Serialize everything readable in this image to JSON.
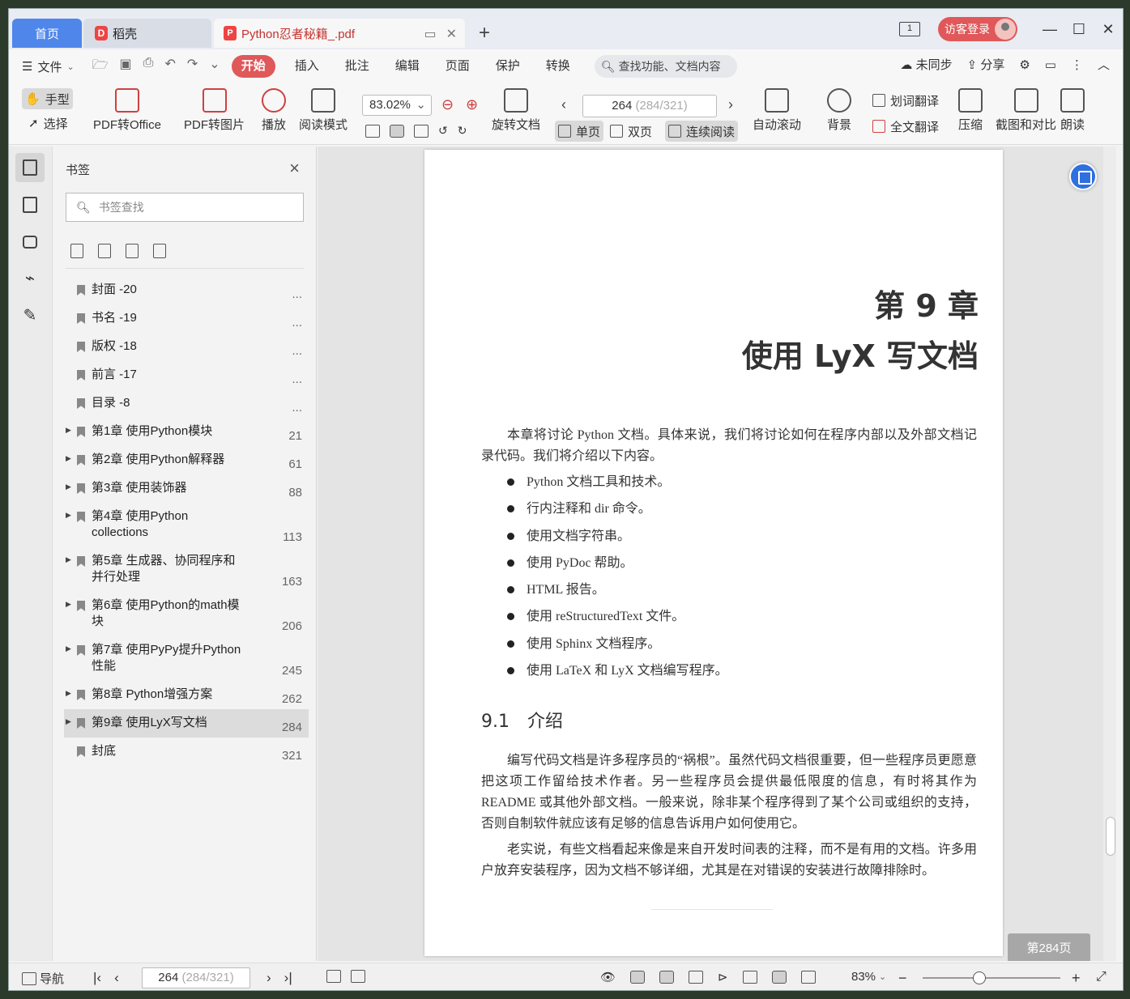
{
  "titlebar": {
    "tab_home": "首页",
    "tab_daoke": "稻壳",
    "tab_pdf": "Python忍者秘籍_.pdf",
    "window_count": "1",
    "visitor_login": "访客登录"
  },
  "menubar": {
    "file": "文件",
    "tabs": [
      "开始",
      "插入",
      "批注",
      "编辑",
      "页面",
      "保护",
      "转换"
    ],
    "search_placeholder": "查找功能、文档内容",
    "sync": "未同步",
    "share": "分享"
  },
  "ribbon": {
    "hand": "手型",
    "select": "选择",
    "pdf_to_office": "PDF转Office",
    "pdf_to_image": "PDF转图片",
    "play": "播放",
    "read_mode": "阅读模式",
    "zoom": "83.02%",
    "rotate_doc": "旋转文档",
    "page_current": "264",
    "page_detail": "(284/321)",
    "single_page": "单页",
    "double_page": "双页",
    "continuous": "连续阅读",
    "auto_scroll": "自动滚动",
    "background": "背景",
    "word_translate": "划词翻译",
    "full_translate": "全文翻译",
    "compress": "压缩",
    "screenshot_compare": "截图和对比",
    "read_aloud": "朗读"
  },
  "bookmarks": {
    "title": "书签",
    "search_placeholder": "书签查找",
    "items": [
      {
        "label": "封面 -20",
        "num": "...",
        "arrow": false
      },
      {
        "label": "书名 -19",
        "num": "...",
        "arrow": false
      },
      {
        "label": "版权 -18",
        "num": "...",
        "arrow": false
      },
      {
        "label": "前言 -17",
        "num": "...",
        "arrow": false
      },
      {
        "label": "目录 -8",
        "num": "...",
        "arrow": false
      },
      {
        "label": "第1章 使用Python模块",
        "num": "21",
        "arrow": true
      },
      {
        "label": "第2章 使用Python解释器",
        "num": "61",
        "arrow": true
      },
      {
        "label": "第3章 使用装饰器",
        "num": "88",
        "arrow": true
      },
      {
        "label": "第4章 使用Python collections",
        "num": "113",
        "arrow": true
      },
      {
        "label": "第5章 生成器、协同程序和并行处理",
        "num": "163",
        "arrow": true
      },
      {
        "label": "第6章 使用Python的math模块",
        "num": "206",
        "arrow": true
      },
      {
        "label": "第7章 使用PyPy提升Python性能",
        "num": "245",
        "arrow": true
      },
      {
        "label": "第8章 Python增强方案",
        "num": "262",
        "arrow": true
      },
      {
        "label": "第9章 使用LyX写文档",
        "num": "284",
        "arrow": true
      },
      {
        "label": "封底",
        "num": "321",
        "arrow": false
      }
    ]
  },
  "document": {
    "chapter_num": "第 9 章",
    "chapter_title": "使用 LyX 写文档",
    "intro": "本章将讨论 Python 文档。具体来说，我们将讨论如何在程序内部以及外部文档记录代码。我们将介绍以下内容。",
    "bullets": [
      "Python 文档工具和技术。",
      "行内注释和 dir 命令。",
      "使用文档字符串。",
      "使用 PyDoc 帮助。",
      "HTML 报告。",
      "使用 reStructuredText 文件。",
      "使用 Sphinx 文档程序。",
      "使用 LaTeX 和 LyX 文档编写程序。"
    ],
    "section_title": "9.1　介绍",
    "para1": "编写代码文档是许多程序员的“祸根”。虽然代码文档很重要，但一些程序员更愿意把这项工作留给技术作者。另一些程序员会提供最低限度的信息，有时将其作为 README 或其他外部文档。一般来说，除非某个程序得到了某个公司或组织的支持，否则自制软件就应该有足够的信息告诉用户如何使用它。",
    "para2": "老实说，有些文档看起来像是来自开发时间表的注释，而不是有用的文档。许多用户放弃安装程序，因为文档不够详细，尤其是在对错误的安装进行故障排除时。",
    "page_label": "第284页"
  },
  "statusbar": {
    "nav": "导航",
    "page_current": "264",
    "page_detail": "(284/321)",
    "zoom": "83%"
  }
}
